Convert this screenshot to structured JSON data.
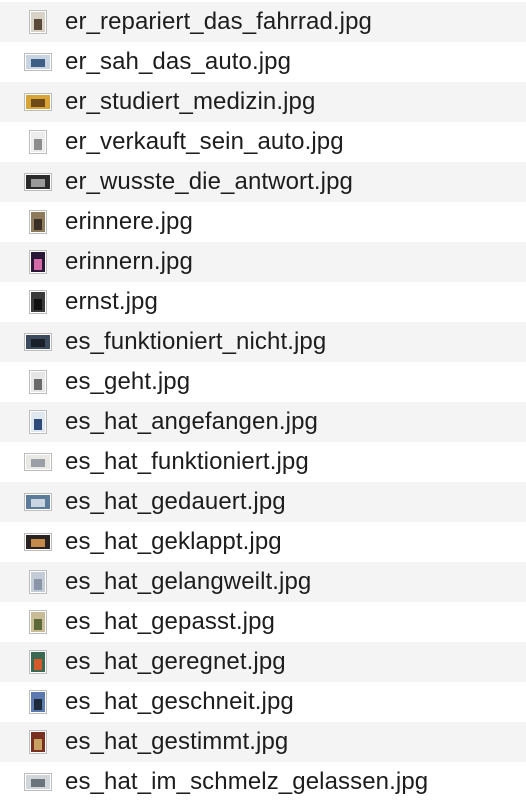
{
  "files": [
    {
      "name": "er_repariert_das_fahrrad.jpg",
      "icon": "photo-thumbnail-icon",
      "orientation": "portrait",
      "colors": [
        "#d8d2c6",
        "#5a4a3c"
      ]
    },
    {
      "name": "er_sah_das_auto.jpg",
      "icon": "photo-thumbnail-icon",
      "orientation": "landscape",
      "colors": [
        "#c9d4e2",
        "#3e5e86"
      ]
    },
    {
      "name": "er_studiert_medizin.jpg",
      "icon": "photo-thumbnail-icon",
      "orientation": "landscape",
      "colors": [
        "#d7a437",
        "#6e4a16"
      ]
    },
    {
      "name": "er_verkauft_sein_auto.jpg",
      "icon": "photo-thumbnail-icon",
      "orientation": "portrait",
      "colors": [
        "#ececec",
        "#8c8c8c"
      ]
    },
    {
      "name": "er_wusste_die_antwort.jpg",
      "icon": "photo-thumbnail-icon",
      "orientation": "landscape",
      "colors": [
        "#2b2b2b",
        "#9a9a9a"
      ]
    },
    {
      "name": "erinnere.jpg",
      "icon": "photo-thumbnail-icon",
      "orientation": "portrait",
      "colors": [
        "#8e7b5c",
        "#3a3026"
      ]
    },
    {
      "name": "erinnern.jpg",
      "icon": "photo-thumbnail-icon",
      "orientation": "portrait",
      "colors": [
        "#2a1838",
        "#d46aa8"
      ]
    },
    {
      "name": "ernst.jpg",
      "icon": "photo-thumbnail-icon",
      "orientation": "portrait",
      "colors": [
        "#3a3a3a",
        "#111111"
      ]
    },
    {
      "name": "es_funktioniert_nicht.jpg",
      "icon": "photo-thumbnail-icon",
      "orientation": "landscape",
      "colors": [
        "#3b4a5c",
        "#1a2028"
      ]
    },
    {
      "name": "es_geht.jpg",
      "icon": "photo-thumbnail-icon",
      "orientation": "portrait",
      "colors": [
        "#e6e6e6",
        "#6a6a6a"
      ]
    },
    {
      "name": "es_hat_angefangen.jpg",
      "icon": "photo-thumbnail-icon",
      "orientation": "portrait",
      "colors": [
        "#dfe7ef",
        "#2e4a78"
      ]
    },
    {
      "name": "es_hat_funktioniert.jpg",
      "icon": "photo-thumbnail-icon",
      "orientation": "landscape",
      "colors": [
        "#e8e8e4",
        "#9aa0a6"
      ]
    },
    {
      "name": "es_hat_gedauert.jpg",
      "icon": "photo-thumbnail-icon",
      "orientation": "landscape",
      "colors": [
        "#5c7a9a",
        "#c8d6e2"
      ]
    },
    {
      "name": "es_hat_geklappt.jpg",
      "icon": "photo-thumbnail-icon",
      "orientation": "landscape",
      "colors": [
        "#2a2220",
        "#c48a4a"
      ]
    },
    {
      "name": "es_hat_gelangweilt.jpg",
      "icon": "photo-thumbnail-icon",
      "orientation": "portrait",
      "colors": [
        "#c4ccd8",
        "#8a96a8"
      ]
    },
    {
      "name": "es_hat_gepasst.jpg",
      "icon": "photo-thumbnail-icon",
      "orientation": "portrait",
      "colors": [
        "#c8bc96",
        "#5c6a3a"
      ]
    },
    {
      "name": "es_hat_geregnet.jpg",
      "icon": "photo-thumbnail-icon",
      "orientation": "portrait",
      "colors": [
        "#3a6a54",
        "#d45a2a"
      ]
    },
    {
      "name": "es_hat_geschneit.jpg",
      "icon": "photo-thumbnail-icon",
      "orientation": "portrait",
      "colors": [
        "#5a7ab0",
        "#1c2a3a"
      ]
    },
    {
      "name": "es_hat_gestimmt.jpg",
      "icon": "photo-thumbnail-icon",
      "orientation": "portrait",
      "colors": [
        "#7a3020",
        "#c8a060"
      ]
    },
    {
      "name": "es_hat_im_schmelz_gelassen.jpg",
      "icon": "photo-thumbnail-icon",
      "orientation": "landscape",
      "colors": [
        "#d0d6da",
        "#6a747a"
      ]
    }
  ],
  "row_striping": {
    "odd": "#f4f4f4",
    "even": "#ffffff"
  }
}
